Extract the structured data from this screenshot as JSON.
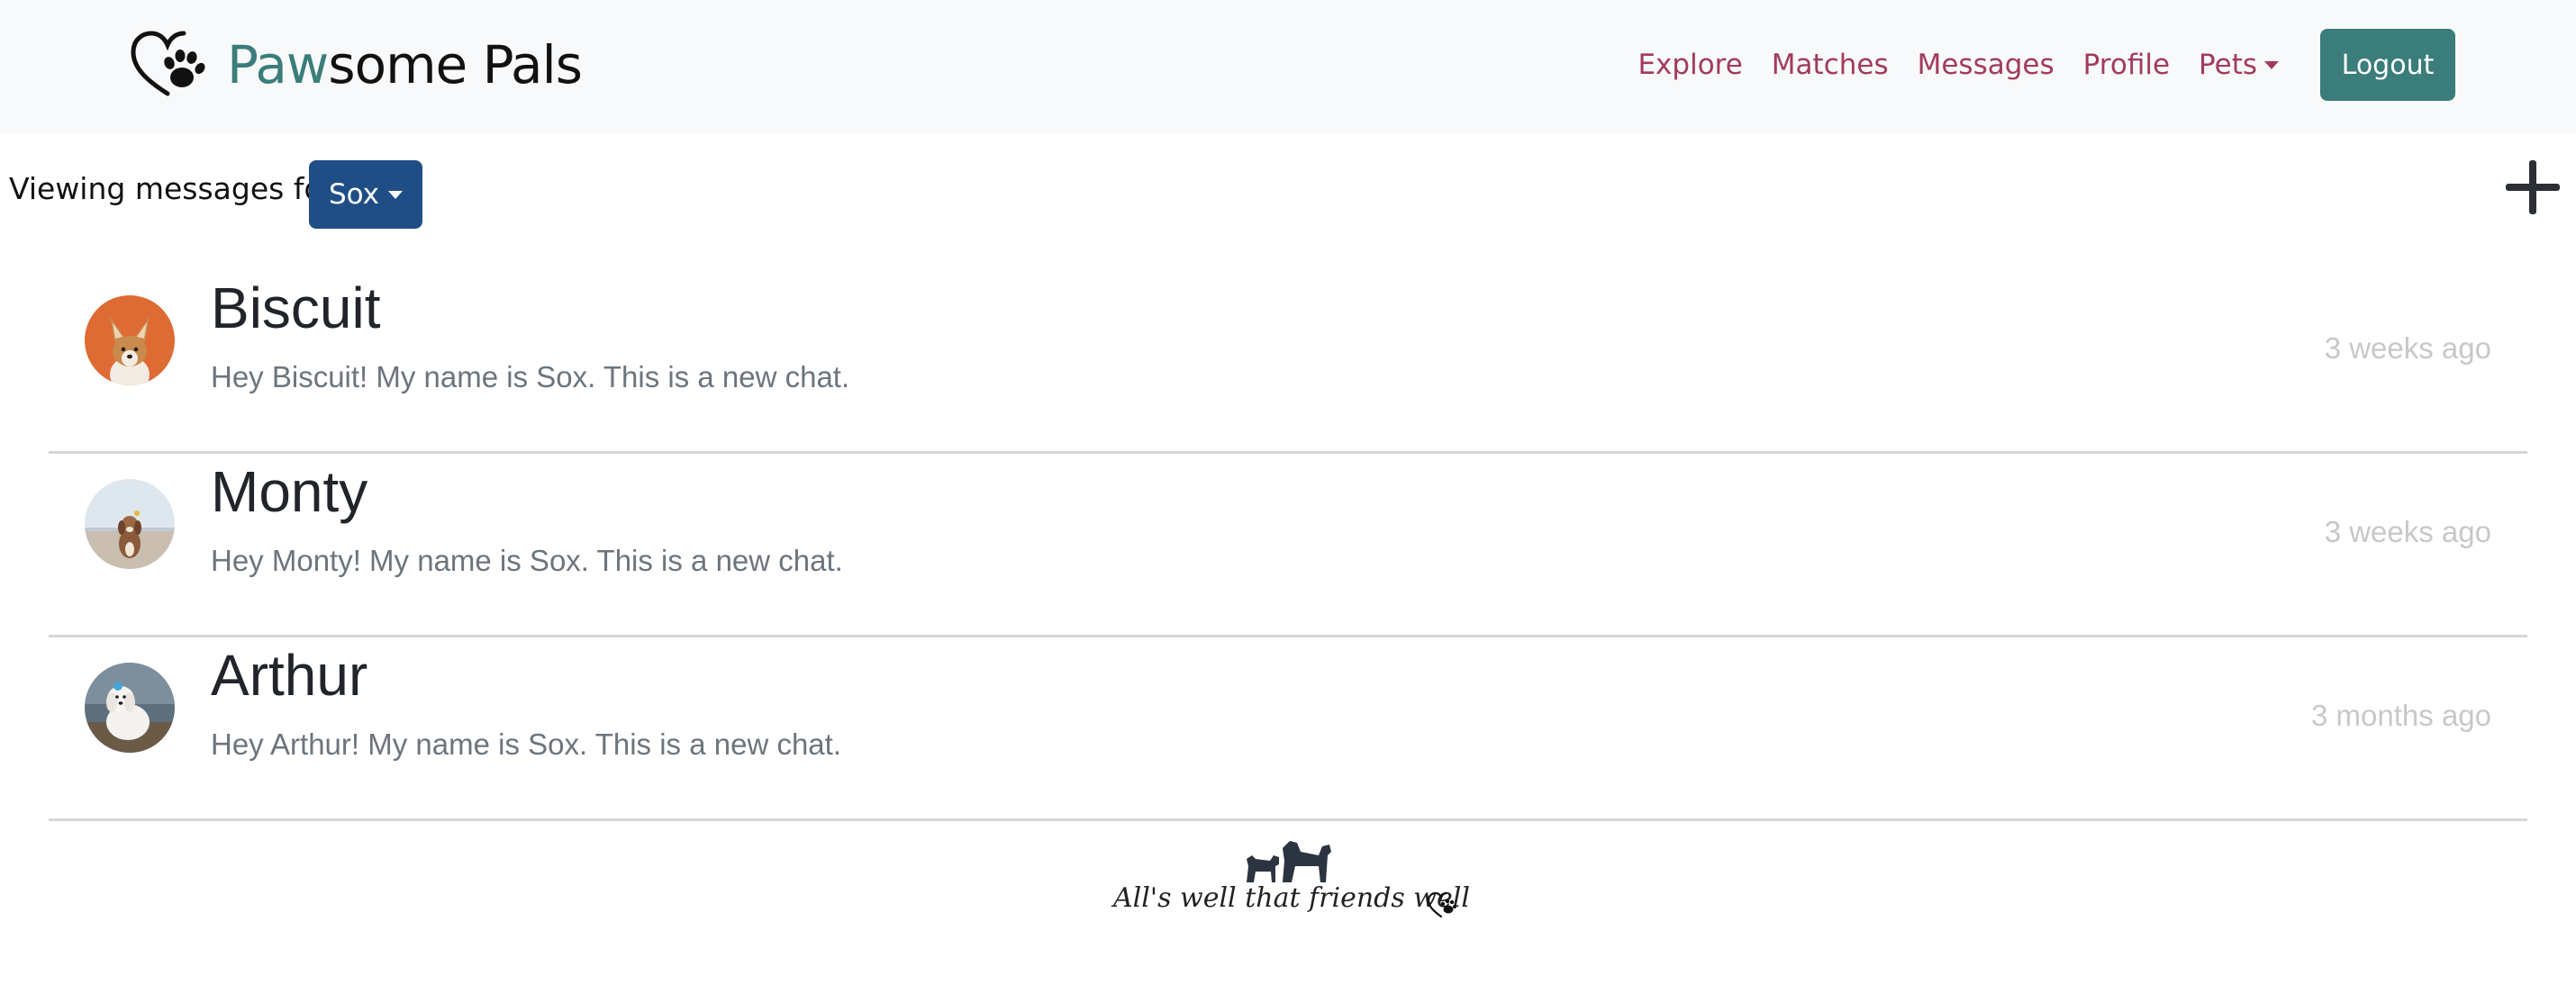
{
  "brand": {
    "name_accent": "Paw",
    "name_rest": "some Pals"
  },
  "nav": {
    "explore": "Explore",
    "matches": "Matches",
    "messages": "Messages",
    "profile": "Profile",
    "pets": "Pets",
    "logout": "Logout"
  },
  "viewing": {
    "label": "Viewing messages for",
    "selected_pet": "Sox"
  },
  "conversations": [
    {
      "name": "Biscuit",
      "preview": "Hey Biscuit! My name is Sox. This is a new chat.",
      "time": "3 weeks ago"
    },
    {
      "name": "Monty",
      "preview": "Hey Monty! My name is Sox. This is a new chat.",
      "time": "3 weeks ago"
    },
    {
      "name": "Arthur",
      "preview": "Hey Arthur! My name is Sox. This is a new chat.",
      "time": "3 months ago"
    }
  ],
  "footer": {
    "tagline": "All's well that friends well"
  },
  "colors": {
    "nav_link": "#a23a5e",
    "brand_accent": "#3a7d7a",
    "logout_button": "#3a7d7a",
    "pet_select": "#1f4e86",
    "navbar_bg": "#f8f9fa"
  },
  "icons": [
    "heart-paw-logo-icon",
    "caret-down-icon",
    "plus-icon",
    "dogs-icon"
  ]
}
